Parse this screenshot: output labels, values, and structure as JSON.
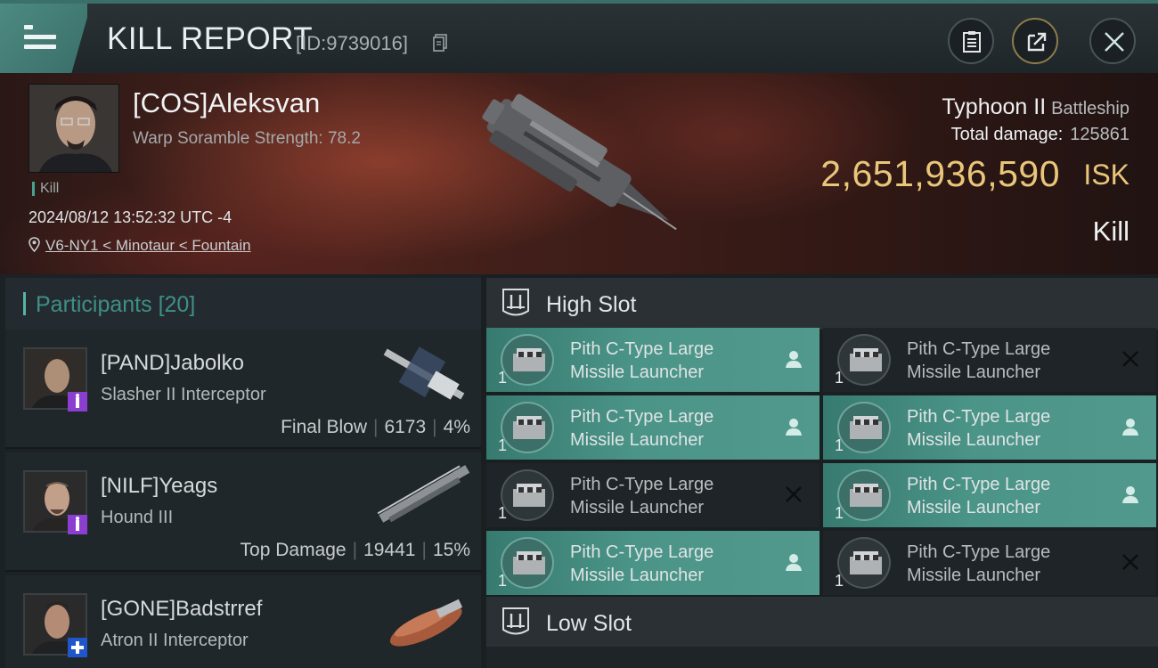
{
  "header": {
    "title": "KILL REPORT",
    "report_id": "[ID:9739016]"
  },
  "victim": {
    "name": "[COS]Aleksvan",
    "warp_scramble": "Warp Soramble Strength: 78.2",
    "tag": "Kill",
    "date": "2024/08/12 13:52:32 UTC -4",
    "location": "V6-NY1 < Minotaur < Fountain",
    "ship": "Typhoon II",
    "ship_class": "Battleship",
    "damage_label": "Total damage:",
    "damage_value": "125861",
    "isk_value": "2,651,936,590",
    "isk_unit": "ISK",
    "result": "Kill"
  },
  "participants": {
    "label": "Participants",
    "count": "[20]",
    "list": [
      {
        "name": "[PAND]Jabolko",
        "ship": "Slasher II Interceptor",
        "role": "Final Blow",
        "damage": "6173",
        "percent": "4%",
        "badge": "purple-bar",
        "badge_color": "#8a3fd1"
      },
      {
        "name": "[NILF]Yeags",
        "ship": "Hound III",
        "role": "Top Damage",
        "damage": "19441",
        "percent": "15%",
        "badge": "purple-bar",
        "badge_color": "#8a3fd1"
      },
      {
        "name": "[GONE]Badstrref",
        "ship": "Atron II Interceptor",
        "role": "",
        "damage": "",
        "percent": "",
        "badge": "blue-plus",
        "badge_color": "#1f56c9"
      }
    ]
  },
  "high_slot": {
    "label": "High Slot",
    "modules": [
      {
        "name_line1": "Pith C-Type Large",
        "name_line2": "Missile Launcher",
        "qty": "1",
        "state": "on",
        "status_icon": "person-icon"
      },
      {
        "name_line1": "Pith C-Type Large",
        "name_line2": "Missile Launcher",
        "qty": "1",
        "state": "off",
        "status_icon": "x-icon"
      },
      {
        "name_line1": "Pith C-Type Large",
        "name_line2": "Missile Launcher",
        "qty": "1",
        "state": "on",
        "status_icon": "person-icon"
      },
      {
        "name_line1": "Pith C-Type Large",
        "name_line2": "Missile Launcher",
        "qty": "1",
        "state": "on",
        "status_icon": "person-icon"
      },
      {
        "name_line1": "Pith C-Type Large",
        "name_line2": "Missile Launcher",
        "qty": "1",
        "state": "off",
        "status_icon": "x-icon"
      },
      {
        "name_line1": "Pith C-Type Large",
        "name_line2": "Missile Launcher",
        "qty": "1",
        "state": "on",
        "status_icon": "person-icon"
      },
      {
        "name_line1": "Pith C-Type Large",
        "name_line2": "Missile Launcher",
        "qty": "1",
        "state": "on",
        "status_icon": "person-icon"
      },
      {
        "name_line1": "Pith C-Type Large",
        "name_line2": "Missile Launcher",
        "qty": "1",
        "state": "off",
        "status_icon": "x-icon"
      }
    ]
  },
  "low_slot": {
    "label": "Low Slot"
  },
  "colors": {
    "accent": "#56b4a4",
    "isk": "#e9c67a",
    "module_on": "#4b9488"
  }
}
